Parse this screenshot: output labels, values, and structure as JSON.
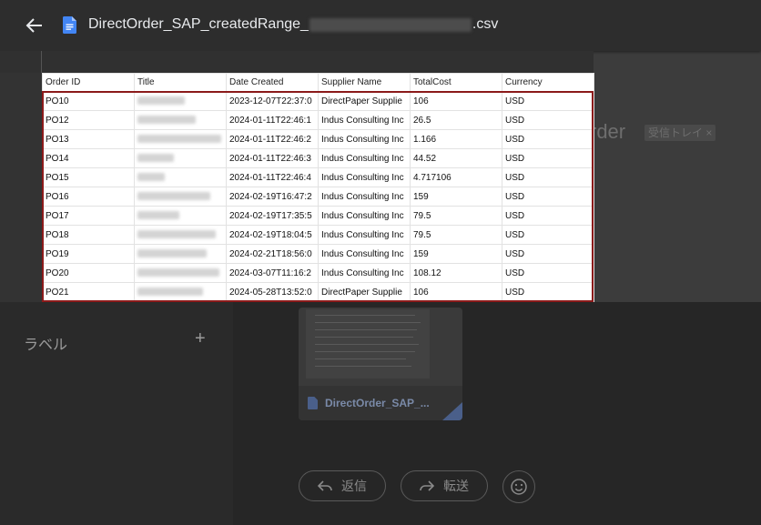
{
  "viewer": {
    "title_prefix": "DirectOrder_SAP_createdRange_",
    "title_suffix": ".csv"
  },
  "table": {
    "columns": [
      "Order ID",
      "Title",
      "Date Created",
      "Supplier Name",
      "TotalCost",
      "Currency"
    ],
    "rows": [
      [
        "PO10",
        "",
        "2023-12-07T22:37:0",
        "DirectPaper Supplie",
        "106",
        "USD"
      ],
      [
        "PO12",
        "",
        "2024-01-11T22:46:1",
        "Indus Consulting Inc",
        "26.5",
        "USD"
      ],
      [
        "PO13",
        "",
        "2024-01-11T22:46:2",
        "Indus Consulting Inc",
        "1.166",
        "USD"
      ],
      [
        "PO14",
        "",
        "2024-01-11T22:46:3",
        "Indus Consulting Inc",
        "44.52",
        "USD"
      ],
      [
        "PO15",
        "",
        "2024-01-11T22:46:4",
        "Indus Consulting Inc",
        "4.717106",
        "USD"
      ],
      [
        "PO16",
        "",
        "2024-02-19T16:47:2",
        "Indus Consulting Inc",
        "159",
        "USD"
      ],
      [
        "PO17",
        "",
        "2024-02-19T17:35:5",
        "Indus Consulting Inc",
        "79.5",
        "USD"
      ],
      [
        "PO18",
        "",
        "2024-02-19T18:04:5",
        "Indus Consulting Inc",
        "79.5",
        "USD"
      ],
      [
        "PO19",
        "",
        "2024-02-21T18:56:0",
        "Indus Consulting Inc",
        "159",
        "USD"
      ],
      [
        "PO20",
        "",
        "2024-03-07T11:16:2",
        "Indus Consulting Inc",
        "108.12",
        "USD"
      ],
      [
        "PO21",
        "",
        "2024-05-28T13:52:0",
        "DirectPaper Supplie",
        "106",
        "USD"
      ]
    ]
  },
  "background": {
    "subject_suffix": "rder",
    "inbox_chip": "受信トレイ ×",
    "labels_heading": "ラベル",
    "labels_add": "+",
    "attachment_name": "DirectOrder_SAP_...",
    "reply_label": "返信",
    "forward_label": "転送"
  },
  "icons": {
    "back": "arrow-left-icon",
    "file": "google-docs-file-icon",
    "add": "plus-icon",
    "reply": "reply-arrow-icon",
    "forward": "forward-arrow-icon",
    "emoji": "smiley-icon"
  },
  "colors": {
    "highlight_border": "#8b1a1a",
    "file_icon": "#4285f4"
  }
}
